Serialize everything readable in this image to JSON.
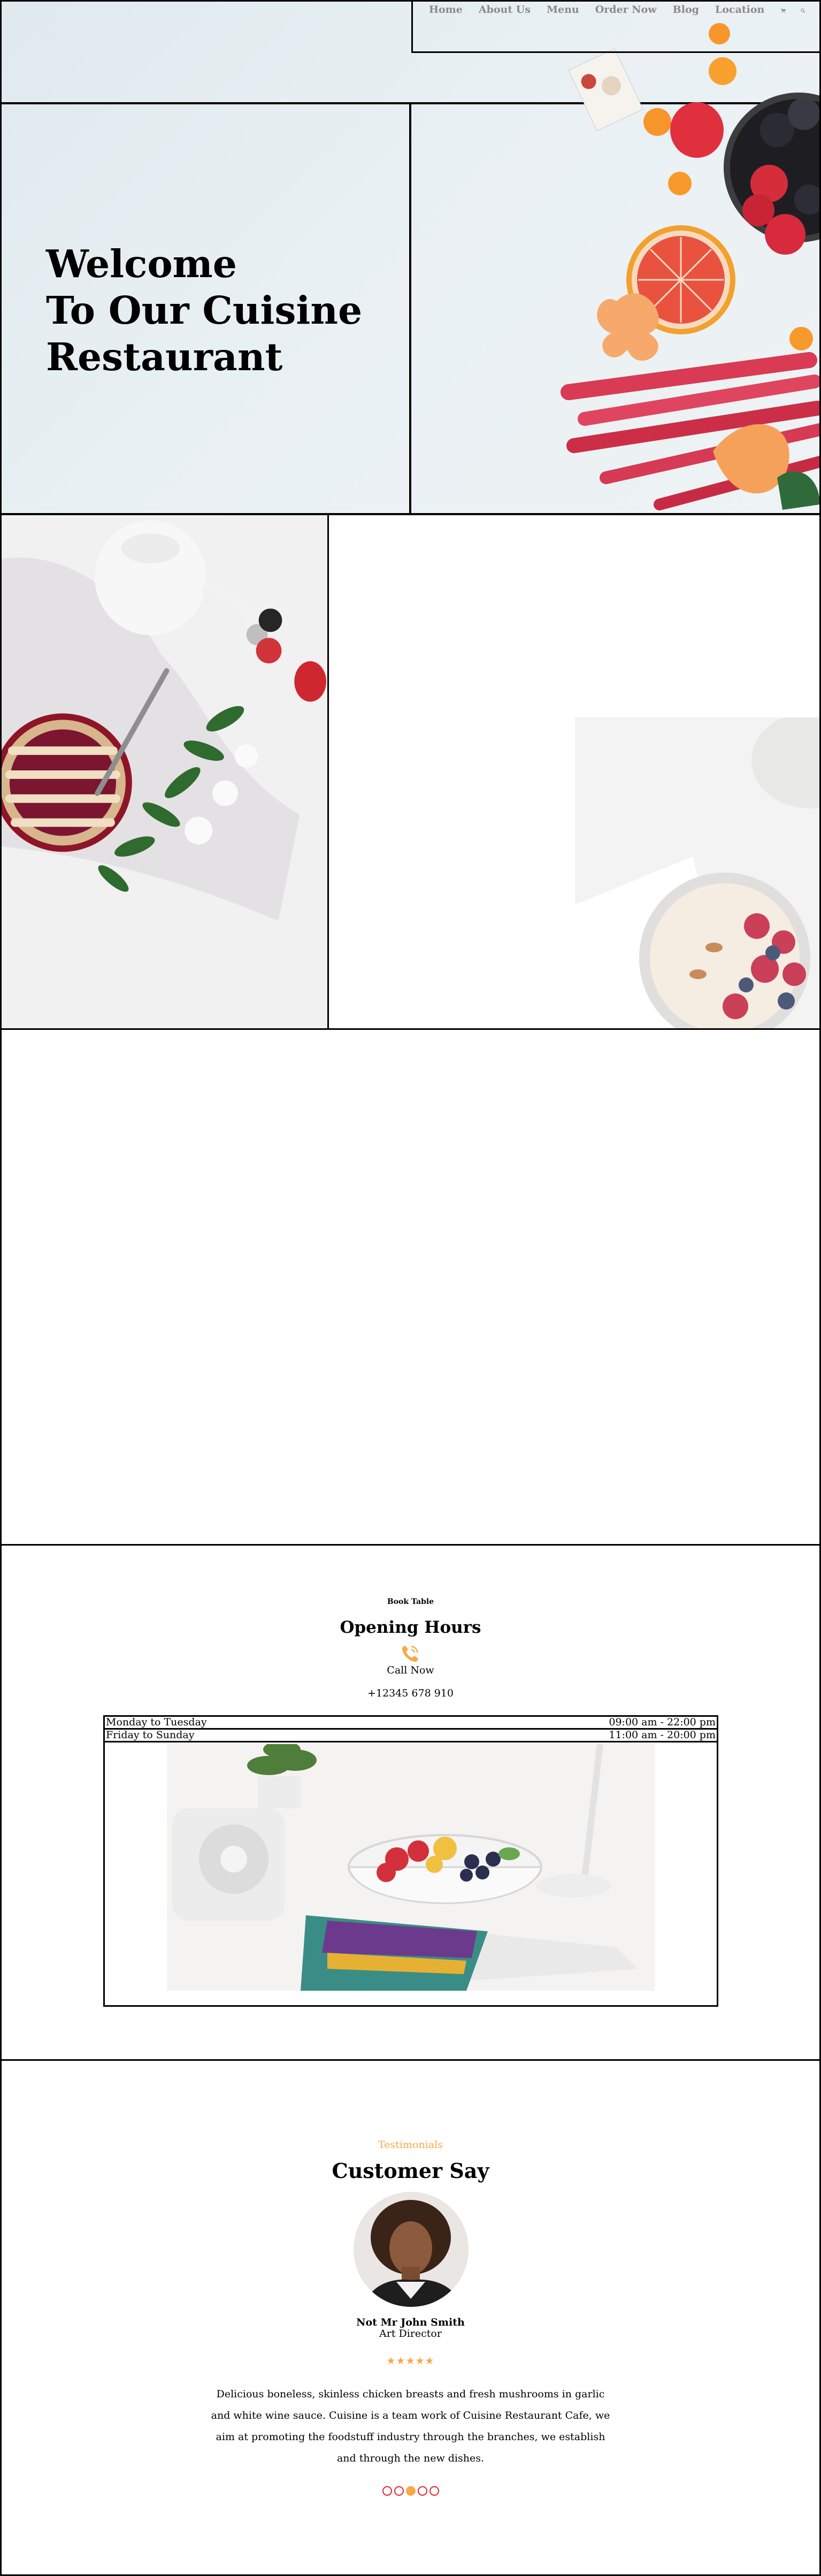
{
  "nav": {
    "links": [
      "Home",
      "About Us",
      "Menu",
      "Order Now",
      "Blog",
      "Location"
    ],
    "icons": [
      "cart-icon",
      "search-icon"
    ]
  },
  "hero": {
    "title": "Welcome\nTo Our Cuisine\nRestaurant"
  },
  "book": {
    "eyebrow": "Book Table",
    "title": "Opening Hours",
    "call_label": "Call Now",
    "phone": "+12345 678 910",
    "hours": [
      {
        "days": "Monday to Tuesday",
        "time": "09:00 am - 22:00 pm"
      },
      {
        "days": "Friday to Sunday",
        "time": "11:00 am - 20:00 pm"
      }
    ]
  },
  "testimonials": {
    "eyebrow": "Testimonials",
    "title": "Customer Say",
    "name": "Not Mr John Smith",
    "role": "Art Director",
    "stars": "★★★★★",
    "rating": 5,
    "quote": "Delicious boneless, skinless chicken breasts and fresh mushrooms in garlic and white wine sauce. Cuisine is a team work of Cuisine Restaurant Cafe, we aim at promoting the foodstuff industry through the branches, we establish and through the new dishes.",
    "slides": 5,
    "active_slide": 2
  },
  "colors": {
    "accent": "#f7a847",
    "dot_border": "#e3262f",
    "nav_text": "#8a8a8a"
  }
}
